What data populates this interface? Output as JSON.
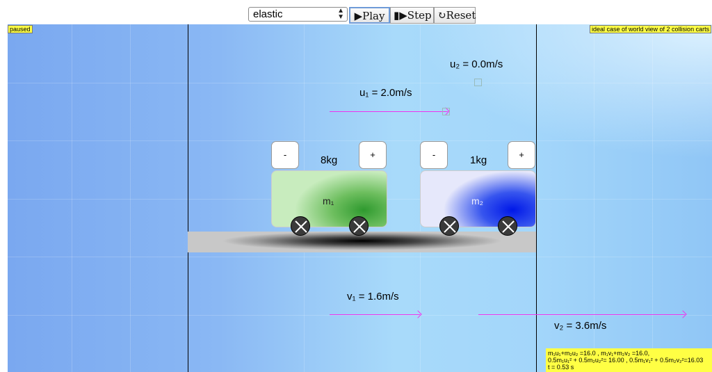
{
  "toolbar": {
    "collision_type": "elastic",
    "play_label": "▶Play",
    "step_label": "▮▶Step",
    "reset_label": "↻Reset"
  },
  "status": "paused",
  "caption": "ideal case of world view of 2 collision carts",
  "initial": {
    "u1_label": "u₁ = 2.0m/s",
    "u2_label": "u₂ = 0.0m/s"
  },
  "final": {
    "v1_label": "v₁ = 1.6m/s",
    "v2_label": "v₂ = 3.6m/s"
  },
  "cart1": {
    "name": "m₁",
    "mass": "8kg",
    "minus": "-",
    "plus": "+",
    "color": "#2f9a2f"
  },
  "cart2": {
    "name": "m₂",
    "mass": "1kg",
    "minus": "-",
    "plus": "+",
    "color": "#0018e8"
  },
  "info": {
    "momentum": "m₁u₁+m₂u₂ =16.0 , m₁v₁+m₂v₂ =16.0,",
    "energy": "0.5m₁u₁² + 0.5m₂u₂²= 16.00 , 0.5m₁v₁² + 0.5m₂v₂²=16.03",
    "time": "t = 0.53 s"
  },
  "colors": {
    "arrow": "#ee33ee",
    "stage_bg": "#a3d6fa",
    "highlight": "#ffff44"
  }
}
